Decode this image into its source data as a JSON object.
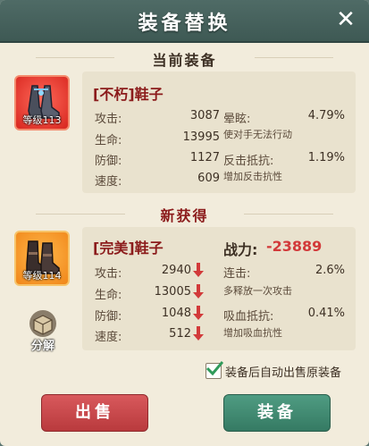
{
  "window": {
    "title": "装备替换"
  },
  "current": {
    "section_title": "当前装备",
    "item_name": "[不朽]鞋子",
    "level_label": "等级113",
    "stats": [
      {
        "label": "攻击:",
        "value": "3087"
      },
      {
        "label": "生命:",
        "value": "13995"
      },
      {
        "label": "防御:",
        "value": "1127"
      },
      {
        "label": "速度:",
        "value": "609"
      }
    ],
    "extra": [
      {
        "label": "晕眩:",
        "value": "4.79%",
        "desc": "使对手无法行动"
      },
      {
        "label": "反击抵抗:",
        "value": "1.19%",
        "desc": "增加反击抗性"
      }
    ]
  },
  "new": {
    "section_title": "新获得",
    "item_name": "[完美]鞋子",
    "level_label": "等级114",
    "power_label": "战力:",
    "power_value": "-23889",
    "stats": [
      {
        "label": "攻击:",
        "value": "2940"
      },
      {
        "label": "生命:",
        "value": "13005"
      },
      {
        "label": "防御:",
        "value": "1048"
      },
      {
        "label": "速度:",
        "value": "512"
      }
    ],
    "extra": [
      {
        "label": "连击:",
        "value": "2.6%",
        "desc": "多释放一次攻击"
      },
      {
        "label": "吸血抵抗:",
        "value": "0.41%",
        "desc": "增加吸血抗性"
      }
    ],
    "decompose_label": "分解"
  },
  "auto_sell": {
    "label": "装备后自动出售原装备",
    "checked": true
  },
  "buttons": {
    "sell": "出售",
    "equip": "装备"
  },
  "colors": {
    "sell": "#c9474a",
    "equip": "#3f8a72",
    "down_arrow": "#d23a3a",
    "power_negative": "#d23a3a"
  }
}
